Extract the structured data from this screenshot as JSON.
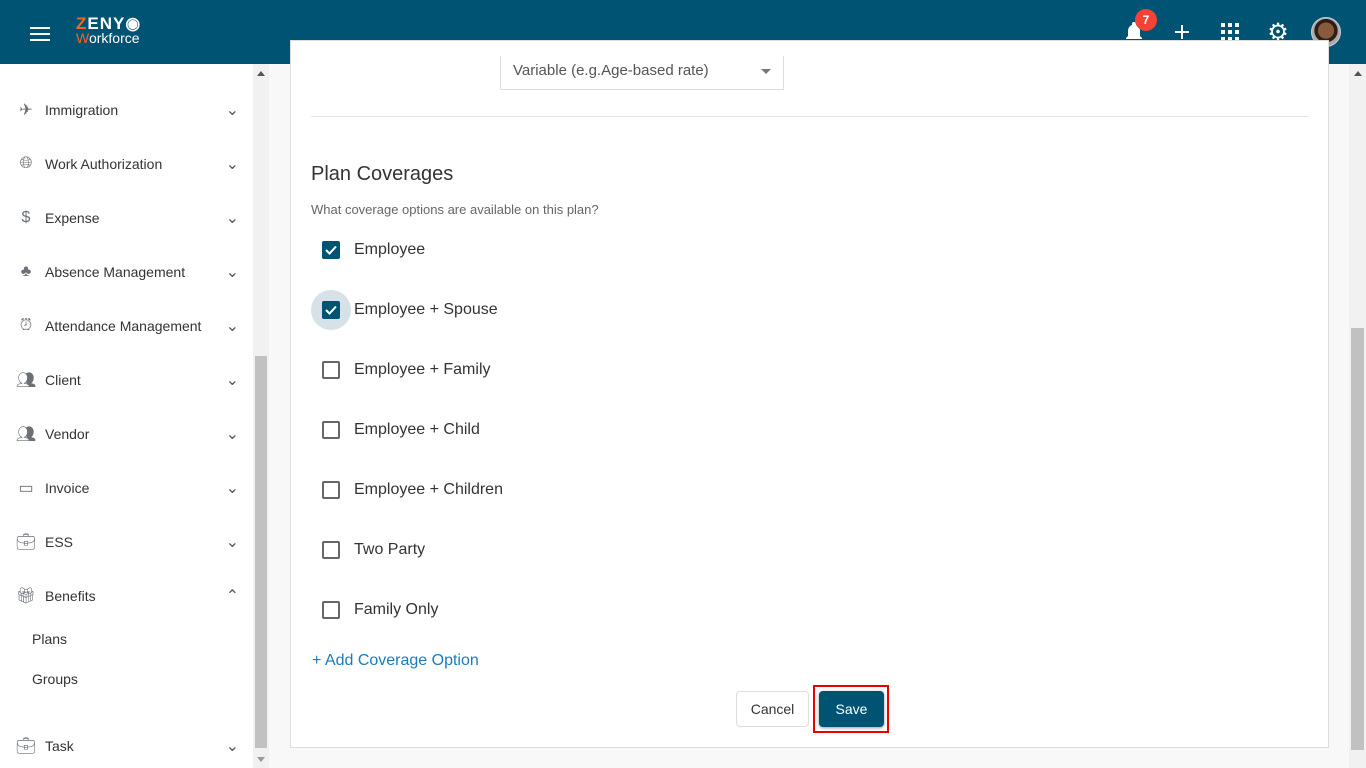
{
  "header": {
    "logo_top": "ZENY",
    "logo_bottom": "Workforce",
    "notification_count": "7",
    "icons": [
      "menu-icon",
      "bell-icon",
      "plus-icon",
      "apps-grid-icon",
      "gear-icon",
      "avatar"
    ]
  },
  "sidebar": {
    "items": [
      {
        "label": "Immigration",
        "icon": "airplane-icon",
        "expanded": false
      },
      {
        "label": "Work Authorization",
        "icon": "globe-icon",
        "expanded": false
      },
      {
        "label": "Expense",
        "icon": "dollar-icon",
        "expanded": false
      },
      {
        "label": "Absence Management",
        "icon": "person-tree-icon",
        "expanded": false
      },
      {
        "label": "Attendance Management",
        "icon": "alarm-icon",
        "expanded": false
      },
      {
        "label": "Client",
        "icon": "people-icon",
        "expanded": false
      },
      {
        "label": "Vendor",
        "icon": "people-icon",
        "expanded": false
      },
      {
        "label": "Invoice",
        "icon": "card-icon",
        "expanded": false
      },
      {
        "label": "ESS",
        "icon": "briefcase-icon",
        "expanded": false
      },
      {
        "label": "Benefits",
        "icon": "gift-icon",
        "expanded": true
      },
      {
        "label": "Task",
        "icon": "briefcase-icon",
        "expanded": false
      }
    ],
    "benefits_sub": [
      "Plans",
      "Groups"
    ]
  },
  "main": {
    "rate_select": "Variable (e.g.Age-based rate)",
    "section_title": "Plan Coverages",
    "section_desc": "What coverage options are available on this plan?",
    "coverages": [
      {
        "label": "Employee",
        "checked": true
      },
      {
        "label": "Employee + Spouse",
        "checked": true,
        "focused": true
      },
      {
        "label": "Employee + Family",
        "checked": false
      },
      {
        "label": "Employee + Child",
        "checked": false
      },
      {
        "label": "Employee + Children",
        "checked": false
      },
      {
        "label": "Two Party",
        "checked": false
      },
      {
        "label": "Family Only",
        "checked": false
      }
    ],
    "add_option": "+ Add Coverage Option",
    "cancel": "Cancel",
    "save": "Save"
  },
  "colors": {
    "primary": "#005373",
    "accent": "#f26522",
    "badge": "#f44336",
    "link": "#1a7bbd",
    "highlight": "#e00000"
  }
}
